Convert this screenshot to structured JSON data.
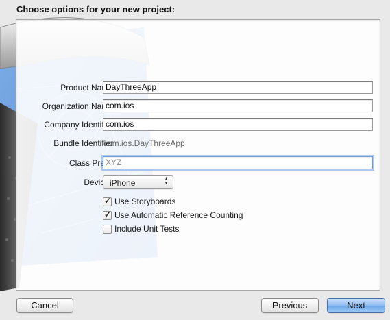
{
  "dialog": {
    "title": "Choose options for your new project:"
  },
  "form": {
    "product_name": {
      "label": "Product Name",
      "value": "DayThreeApp"
    },
    "organization_name": {
      "label": "Organization Name",
      "value": "com.ios"
    },
    "company_identifier": {
      "label": "Company Identifier",
      "value": "com.ios"
    },
    "bundle_identifier": {
      "label": "Bundle Identifier",
      "value": "com.ios.DayThreeApp"
    },
    "class_prefix": {
      "label": "Class Prefix",
      "value": "",
      "placeholder": "XYZ"
    },
    "devices": {
      "label": "Devices",
      "value": "iPhone"
    },
    "options": [
      {
        "label": "Use Storyboards",
        "checked": true
      },
      {
        "label": "Use Automatic Reference Counting",
        "checked": true
      },
      {
        "label": "Include Unit Tests",
        "checked": false
      }
    ]
  },
  "buttons": {
    "cancel": "Cancel",
    "previous": "Previous",
    "next": "Next"
  },
  "colors": {
    "accent": "#6ea6e8",
    "blueprint": "#3f7ed1"
  }
}
